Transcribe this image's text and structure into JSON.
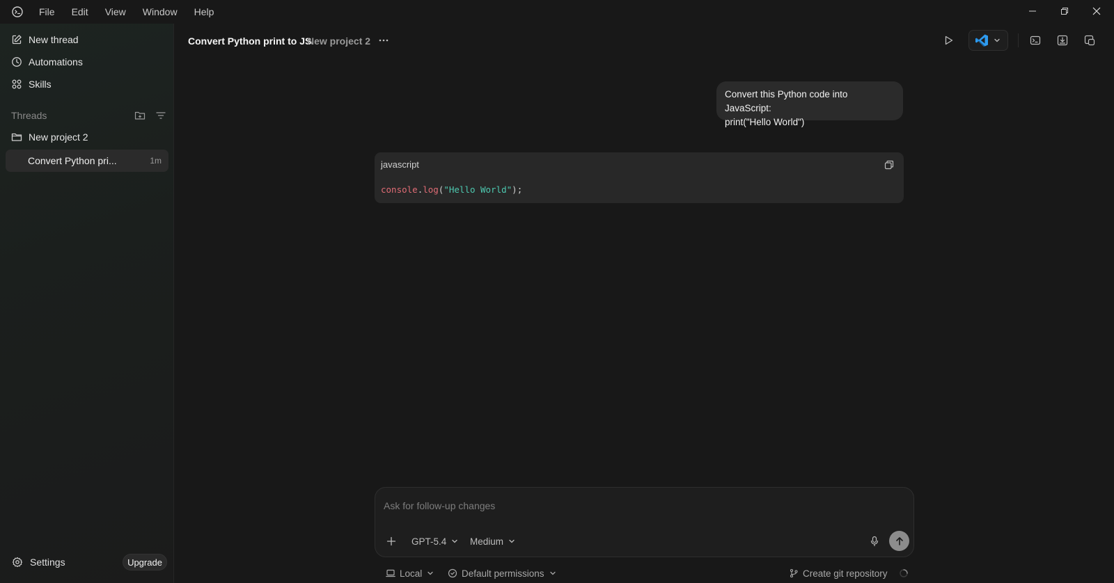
{
  "menu": [
    "File",
    "Edit",
    "View",
    "Window",
    "Help"
  ],
  "sidebar": {
    "nav": [
      {
        "label": "New thread",
        "icon": "edit-icon"
      },
      {
        "label": "Automations",
        "icon": "clock-icon"
      },
      {
        "label": "Skills",
        "icon": "grid-icon"
      }
    ],
    "threads_label": "Threads",
    "project": {
      "label": "New project 2",
      "icon": "folder-icon"
    },
    "thread": {
      "title": "Convert Python pri...",
      "time": "1m"
    },
    "settings_label": "Settings",
    "upgrade_label": "Upgrade"
  },
  "header": {
    "title": "Convert Python print to JS",
    "project": "New project 2"
  },
  "conversation": {
    "user_message_line1": "Convert this Python code into JavaScript:",
    "user_message_line2": "print(\"Hello World\")",
    "code": {
      "language": "javascript",
      "tokens": {
        "object": "console",
        "dot": ".",
        "method": "log",
        "open": "(",
        "string": "\"Hello World\"",
        "close": ");"
      }
    }
  },
  "composer": {
    "placeholder": "Ask for follow-up changes",
    "model": "GPT-5.4",
    "effort": "Medium"
  },
  "footer": {
    "environment": "Local",
    "permissions": "Default permissions",
    "git": "Create git repository"
  },
  "colors": {
    "background": "#181818",
    "sidebar": "#1b1f1d",
    "card": "#2b2b2b",
    "code_keyword": "#e06c75",
    "code_string": "#4ec9b0",
    "vscode_blue": "#2e9bf0"
  }
}
